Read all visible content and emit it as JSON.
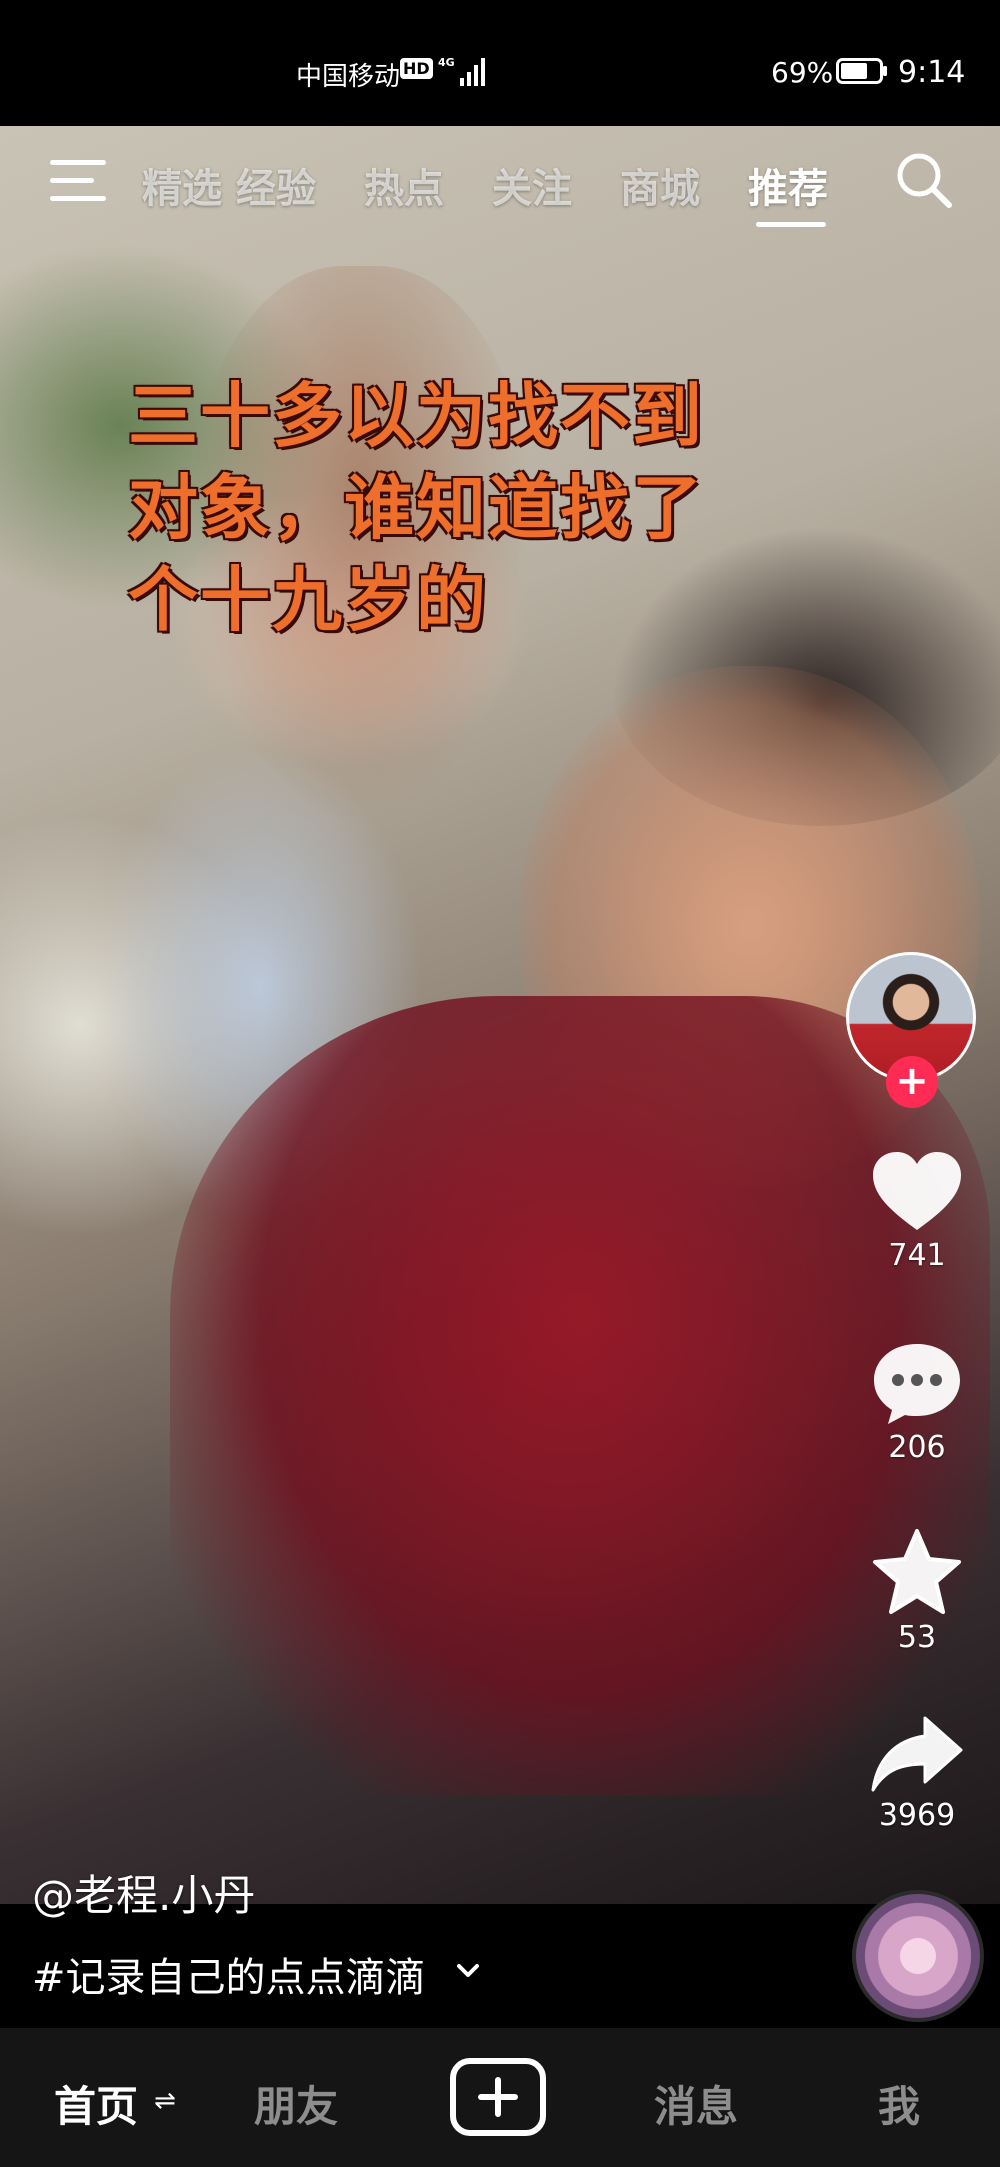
{
  "status_bar": {
    "carrier": "中国移动",
    "hd_badge": "HD",
    "network": "4G",
    "battery_percent": "69%",
    "time": "9:14"
  },
  "top_tabs": {
    "items": [
      {
        "label": "精选",
        "active": false
      },
      {
        "label": "经验",
        "active": false
      },
      {
        "label": "热点",
        "active": false
      },
      {
        "label": "关注",
        "active": false
      },
      {
        "label": "商城",
        "active": false
      },
      {
        "label": "推荐",
        "active": true
      }
    ],
    "menu_icon": "menu-icon",
    "search_icon": "search-icon"
  },
  "video": {
    "caption_lines": [
      "三十多以为找不到",
      "对象，谁知道找了",
      "个十九岁的"
    ],
    "author": "@老程.小丹",
    "hashtag": "#记录自己的点点滴滴"
  },
  "actions": {
    "likes": "741",
    "comments": "206",
    "favorites": "53",
    "shares": "3969",
    "follow_icon": "plus-icon"
  },
  "bottom_nav": {
    "home": "首页",
    "friends": "朋友",
    "messages": "消息",
    "me": "我",
    "create_icon": "plus-square-icon"
  },
  "colors": {
    "caption": "#ee6e2b",
    "follow_button": "#fe2c55",
    "nav_background": "#151515"
  }
}
